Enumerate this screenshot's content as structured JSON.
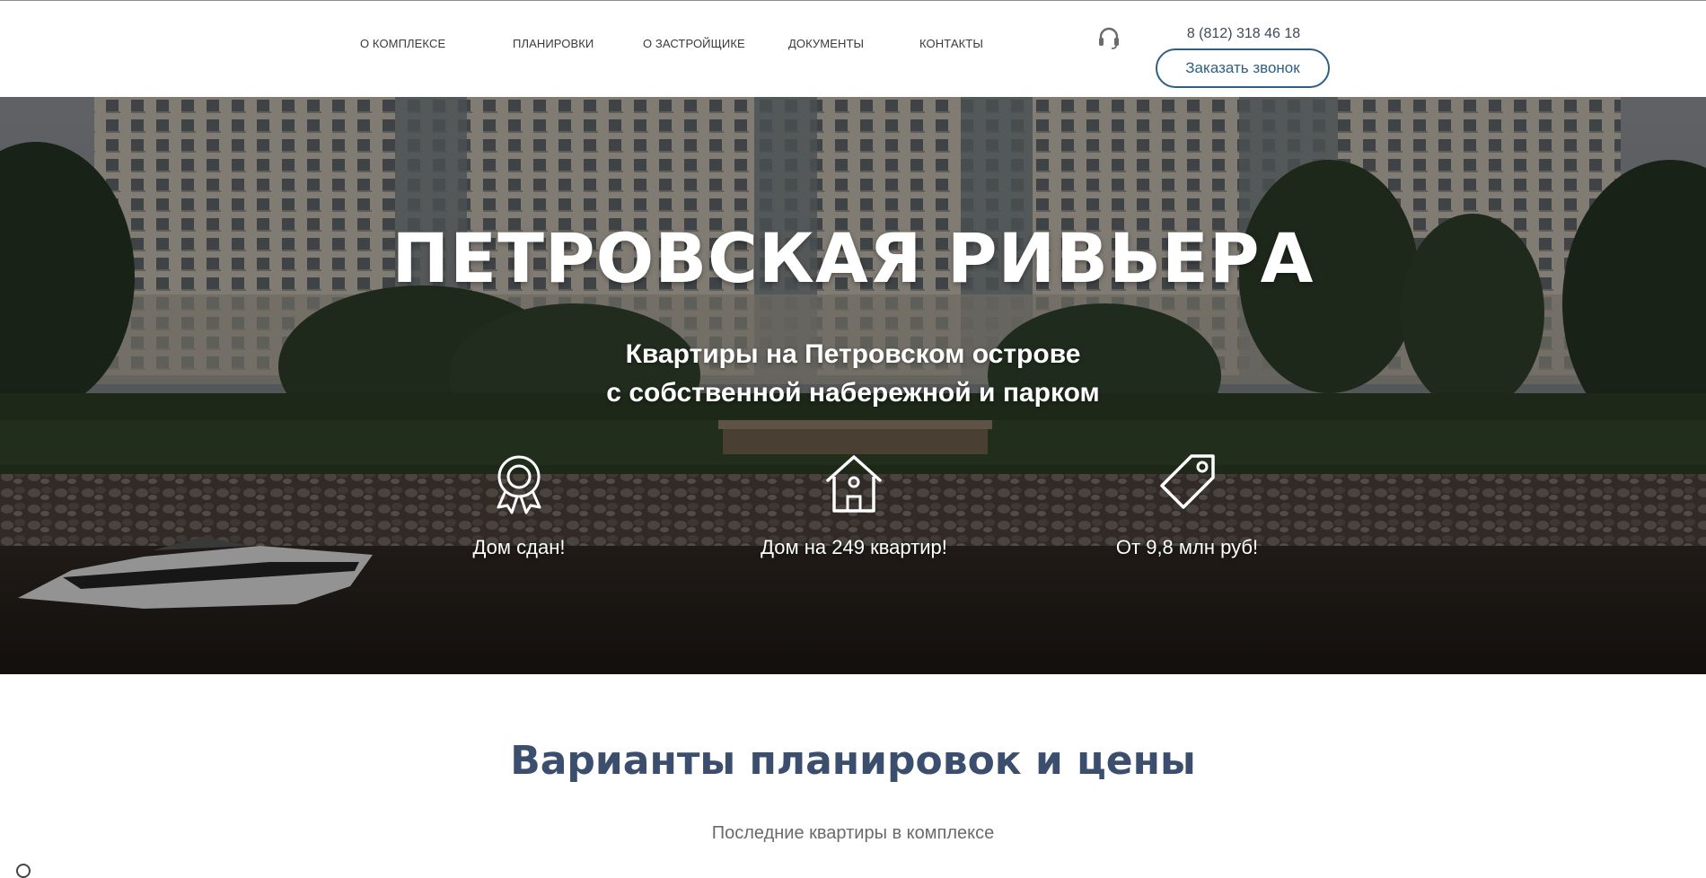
{
  "nav": {
    "items": [
      {
        "label": "О комплексе"
      },
      {
        "label": "Планировки"
      },
      {
        "label": "О застройщике"
      },
      {
        "label": "Документы"
      },
      {
        "label": "Контакты"
      }
    ],
    "phone": "8 (812) 318 46 18",
    "call_button": "Заказать звонок"
  },
  "hero": {
    "title": "ПЕТРОВСКАЯ РИВЬЕРА",
    "subtitle_line1": "Квартиры на Петровском острове",
    "subtitle_line2": "с собственной набережной и парком",
    "features": [
      {
        "icon": "award-ribbon-icon",
        "label": "Дом сдан!"
      },
      {
        "icon": "house-icon",
        "label": "Дом на 249 квартир!"
      },
      {
        "icon": "price-tag-icon",
        "label": "От 9,8 млн руб!"
      }
    ]
  },
  "plans_section": {
    "title": "Варианты планировок и цены",
    "subtitle": "Последние квартиры в комплексе"
  },
  "colors": {
    "accent": "#2f5f84",
    "section_title": "#3b4e6d",
    "nav_text": "#3a3a3a"
  }
}
